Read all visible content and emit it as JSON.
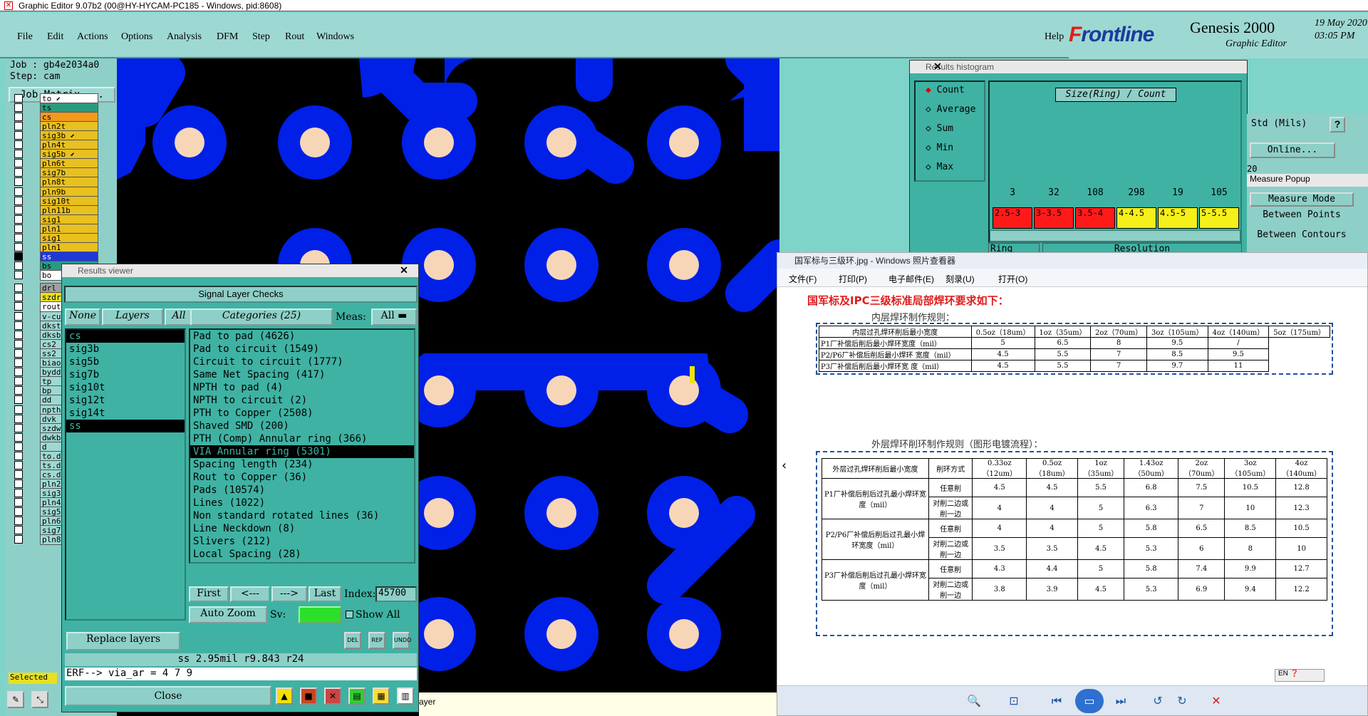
{
  "app": {
    "title": "Graphic Editor 9.07b2 (00@HY-HYCAM-PC185 - Windows, pid:8608)",
    "menus": [
      "File",
      "Edit",
      "Actions",
      "Options",
      "Analysis",
      "DFM",
      "Step",
      "Rout",
      "Windows"
    ],
    "help": "Help",
    "brand": {
      "logo_f": "F",
      "logo_rest": "rontline",
      "product": "Genesis 2000",
      "subtitle": "Graphic Editor",
      "date": "19 May 2020",
      "time": "03:05 PM"
    },
    "colors": {
      "panel": "#8ecfc8",
      "pad_blue": "#0020e8",
      "pad_center": "#f7d6b8",
      "canvas_bg": "#000000",
      "marker": "#f2e200"
    }
  },
  "left_panel": {
    "job": "Job : gb4e2034a0",
    "step": "Step: cam",
    "job_matrix": "Job Matrix ...",
    "layers": [
      {
        "name": "to",
        "color": "#ffffff",
        "arrow": true
      },
      {
        "name": "ts",
        "color": "#2a9a7f"
      },
      {
        "name": "cs",
        "color": "#f29a1a"
      },
      {
        "name": "pln2t",
        "color": "#e8c020"
      },
      {
        "name": "sig3b",
        "color": "#e8c020",
        "arrow": true
      },
      {
        "name": "pln4t",
        "color": "#e8c020"
      },
      {
        "name": "sig5b",
        "color": "#e8c020",
        "arrow": true
      },
      {
        "name": "pln6t",
        "color": "#e8c020"
      },
      {
        "name": "sig7b",
        "color": "#e8c020"
      },
      {
        "name": "pln8t",
        "color": "#e8c020"
      },
      {
        "name": "pln9b",
        "color": "#e8c020"
      },
      {
        "name": "sig10t",
        "color": "#e8c020"
      },
      {
        "name": "pln11b",
        "color": "#e8c020"
      },
      {
        "name": "sig1",
        "color": "#e8c020"
      },
      {
        "name": "pln1",
        "color": "#e8c020"
      },
      {
        "name": "sig1",
        "color": "#e8c020"
      },
      {
        "name": "pln1",
        "color": "#e8c020"
      },
      {
        "name": "ss",
        "color": "#1d39d8",
        "checked": true
      },
      {
        "name": "bs",
        "color": "#2a9a7f"
      },
      {
        "name": "bo",
        "color": "#ffffff"
      }
    ],
    "layers2": [
      {
        "name": "drl",
        "color": "#a0a0a0"
      },
      {
        "name": "szdr",
        "color": "#e8e020"
      },
      {
        "name": "rout",
        "color": "#ffffff"
      }
    ],
    "layers3": [
      "v-cu",
      "dkst",
      "dksb",
      "cs2",
      "ss2",
      "biao",
      "bydd",
      "tp",
      "bp",
      "dd",
      "npth",
      "dvk",
      "szdw",
      "dwkb",
      "d",
      "to.d",
      "ts.d",
      "cs.d",
      "pln2",
      "sig3",
      "pln4",
      "sig5",
      "pln6",
      "sig7",
      "pln8"
    ],
    "selected": "Selected"
  },
  "results_viewer": {
    "title": "Results viewer",
    "header": "Signal Layer Checks",
    "none": "None",
    "layers_btn": "Layers",
    "all": "All",
    "categories_btn": "Categories (25)",
    "meas_label": "Meas:",
    "meas_value": "All",
    "layer_list": [
      "cs",
      "sig3b",
      "sig5b",
      "sig7b",
      "sig10t",
      "sig12t",
      "sig14t",
      "ss"
    ],
    "layer_selected": [
      0,
      7
    ],
    "categories": [
      "Pad to pad (4626)",
      "Pad to circuit (1549)",
      "Circuit to circuit (1777)",
      "Same Net Spacing (417)",
      "NPTH to pad (4)",
      "NPTH to circuit (2)",
      "PTH to Copper (2508)",
      "Shaved SMD (200)",
      "PTH (Comp) Annular ring (366)",
      "VIA Annular ring (5301)",
      "Spacing length (234)",
      "Rout to Copper (36)",
      "Pads (10574)",
      "Lines (1022)",
      "Non standard rotated lines (36)",
      "Line Neckdown (8)",
      "Slivers (212)",
      "Local Spacing (28)"
    ],
    "category_selected": 9,
    "first": "First",
    "prev": "<---",
    "next": "--->",
    "last": "Last",
    "index_label": "Index:",
    "index_value": "45700",
    "auto_zoom": "Auto Zoom",
    "sv_label": "Sv:",
    "show_all": "Show All",
    "replace_layers": "Replace layers",
    "status1": "ss 2.95mil  r9.843  r24",
    "status2": "ERF--> via_ar = 4 7 9",
    "close": "Close",
    "small_btns": [
      "DEL",
      "REP",
      "UNDO"
    ]
  },
  "histogram": {
    "title": "Results histogram",
    "options": [
      "Count",
      "Average",
      "Sum",
      "Min",
      "Max"
    ],
    "chart_title": "Size(Ring) / Count",
    "bins": [
      {
        "label": "2.5-3",
        "count": "3",
        "color": "#ff1a1a"
      },
      {
        "label": "3-3.5",
        "count": "32",
        "color": "#ff1a1a"
      },
      {
        "label": "3.5-4",
        "count": "108",
        "color": "#ff1a1a"
      },
      {
        "label": "4-4.5",
        "count": "298",
        "color": "#f5f019"
      },
      {
        "label": "4.5-5",
        "count": "19",
        "color": "#f5f019"
      },
      {
        "label": "5-5.5",
        "count": "105",
        "color": "#f5f019"
      }
    ],
    "ring": "Ring",
    "resolution": "Resolution"
  },
  "measure": {
    "units": "Std (Mils)",
    "help": "?",
    "online": "Online...",
    "popup_title": "Measure Popup",
    "mode": "Measure Mode",
    "between_points": "Between Points",
    "between_contours": "Between Contours",
    "twenty": "20"
  },
  "photo_viewer": {
    "title": "国军标与三级环.jpg - Windows 照片查看器",
    "menu": [
      "文件(F)",
      "打印(P)",
      "电子邮件(E)",
      "刻录(U)",
      "打开(O)"
    ],
    "heading": "国军标及IPC三级标准局部焊环要求如下：",
    "inner_title": "内层焊环制作规则：",
    "inner_head": [
      "内层过孔焊环削后最小宽度",
      "0.5oz（18um）",
      "1oz（35um）",
      "2oz（70um）",
      "3oz（105um）",
      "4oz（140um）",
      "5oz（175um）"
    ],
    "inner_rows": [
      [
        "P1厂补偿后削后最小焊环宽度（mil）",
        "5",
        "6.5",
        "8",
        "9.5",
        "/"
      ],
      [
        "P2/P6厂补偿后削后最小焊环 宽度（mil）",
        "4.5",
        "5.5",
        "7",
        "8.5",
        "9.5"
      ],
      [
        "P3厂补偿后削后最小焊环宽 度（mil）",
        "4.5",
        "5.5",
        "7",
        "9.7",
        "11"
      ]
    ],
    "outer_title": "外层焊环削环制作规则（图形电镀流程）：",
    "outer_head": [
      "外层过孔焊环削后最小宽度",
      "削环方式",
      "0.33oz（12um）",
      "0.5oz（18um）",
      "1oz（35um）",
      "1.43oz（50um）",
      "2oz（70um）",
      "3oz（105um）",
      "4oz（140um）"
    ],
    "outer_groups": [
      {
        "name": "P1厂补偿后削后过孔最小焊环宽度（mil）",
        "rows": [
          [
            "任意削",
            "4.5",
            "4.5",
            "5.5",
            "6.8",
            "7.5",
            "10.5",
            "12.8"
          ],
          [
            "对削二边或削一边",
            "4",
            "4",
            "5",
            "6.3",
            "7",
            "10",
            "12.3"
          ]
        ]
      },
      {
        "name": "P2/P6厂补偿后削后过孔最小焊环宽度（mil）",
        "rows": [
          [
            "任意削",
            "4",
            "4",
            "5",
            "5.8",
            "6.5",
            "8.5",
            "10.5"
          ],
          [
            "对削二边或削一边",
            "3.5",
            "3.5",
            "4.5",
            "5.3",
            "6",
            "8",
            "10"
          ]
        ]
      },
      {
        "name": "P3厂补偿后削后过孔最小焊环宽度（mil）",
        "rows": [
          [
            "任意削",
            "4.3",
            "4.4",
            "5",
            "5.8",
            "7.4",
            "9.9",
            "12.7"
          ],
          [
            "对削二边或削一边",
            "3.8",
            "3.9",
            "4.5",
            "5.3",
            "6.9",
            "9.4",
            "12.2"
          ]
        ]
      }
    ],
    "lang": "EN"
  },
  "bottom_label": "ayer"
}
